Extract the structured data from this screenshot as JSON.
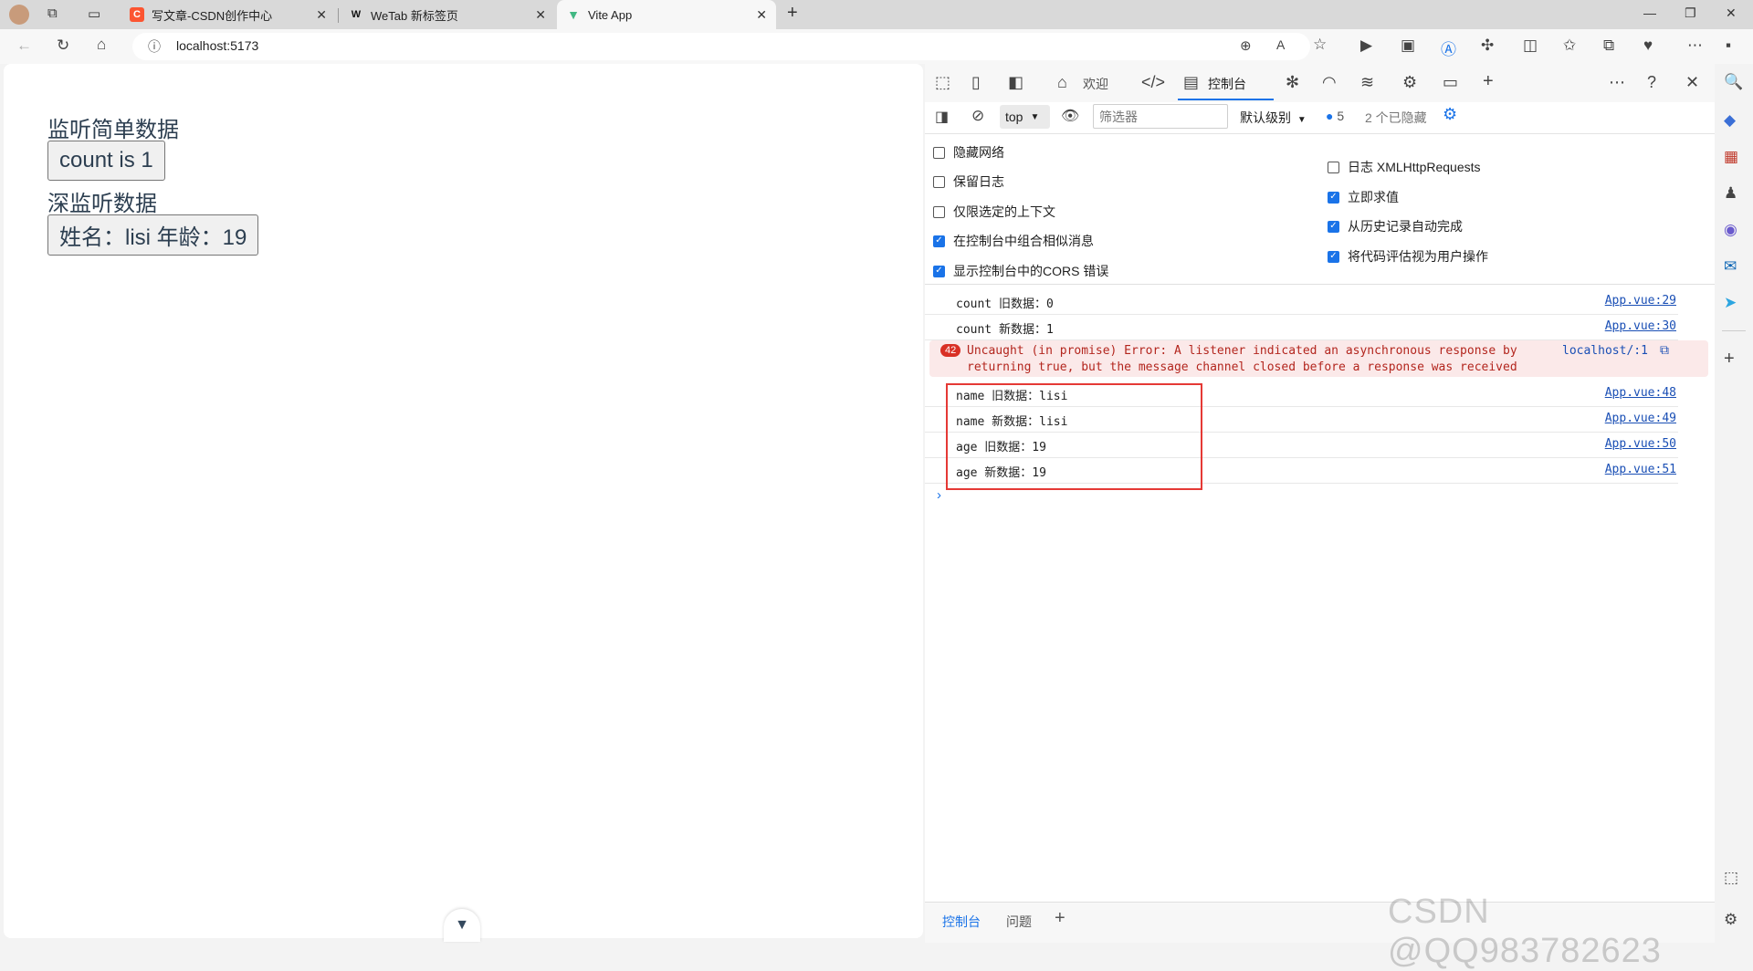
{
  "browser": {
    "tabs": [
      {
        "title": "写文章-CSDN创作中心",
        "favicon": "csdn-logo"
      },
      {
        "title": "WeTab 新标签页",
        "favicon": "wetab-logo"
      },
      {
        "title": "Vite App",
        "favicon": "vue-logo"
      }
    ],
    "address": "localhost:5173"
  },
  "page": {
    "heading1": "监听简单数据",
    "button1": "count is 1",
    "heading2": "深监听数据",
    "button2": "姓名：lisi 年龄：19"
  },
  "devtools": {
    "tabs": {
      "welcome": "欢迎",
      "console": "控制台"
    },
    "filterbar": {
      "context": "top",
      "filter_placeholder": "筛选器",
      "level": "默认级别",
      "issues_count": "5",
      "hidden": "2 个已隐藏"
    },
    "settings_left": [
      {
        "label": "隐藏网络",
        "checked": false
      },
      {
        "label": "保留日志",
        "checked": false
      },
      {
        "label": "仅限选定的上下文",
        "checked": false
      },
      {
        "label": "在控制台中组合相似消息",
        "checked": true
      },
      {
        "label": "显示控制台中的CORS 错误",
        "checked": true
      }
    ],
    "settings_right": [
      {
        "label": "日志 XMLHttpRequests",
        "checked": false
      },
      {
        "label": "立即求值",
        "checked": true
      },
      {
        "label": "从历史记录自动完成",
        "checked": true
      },
      {
        "label": "将代码评估视为用户操作",
        "checked": true
      }
    ],
    "logs": [
      {
        "msg": "count 旧数据：0",
        "src": "App.vue:29"
      },
      {
        "msg": "count 新数据：1",
        "src": "App.vue:30"
      }
    ],
    "error": {
      "count": "42",
      "line1": "Uncaught (in promise) Error: A listener indicated an asynchronous response by",
      "line2": "returning true, but the message channel closed before a response was received",
      "src": "localhost/:1"
    },
    "logs2": [
      {
        "msg": "name 旧数据：lisi",
        "src": "App.vue:48"
      },
      {
        "msg": "name 新数据：lisi",
        "src": "App.vue:49"
      },
      {
        "msg": "age 旧数据：19",
        "src": "App.vue:50"
      },
      {
        "msg": "age 新数据：19",
        "src": "App.vue:51"
      }
    ],
    "drawer": {
      "console": "控制台",
      "issues": "问题"
    }
  },
  "watermark": "CSDN @QQ983782623"
}
